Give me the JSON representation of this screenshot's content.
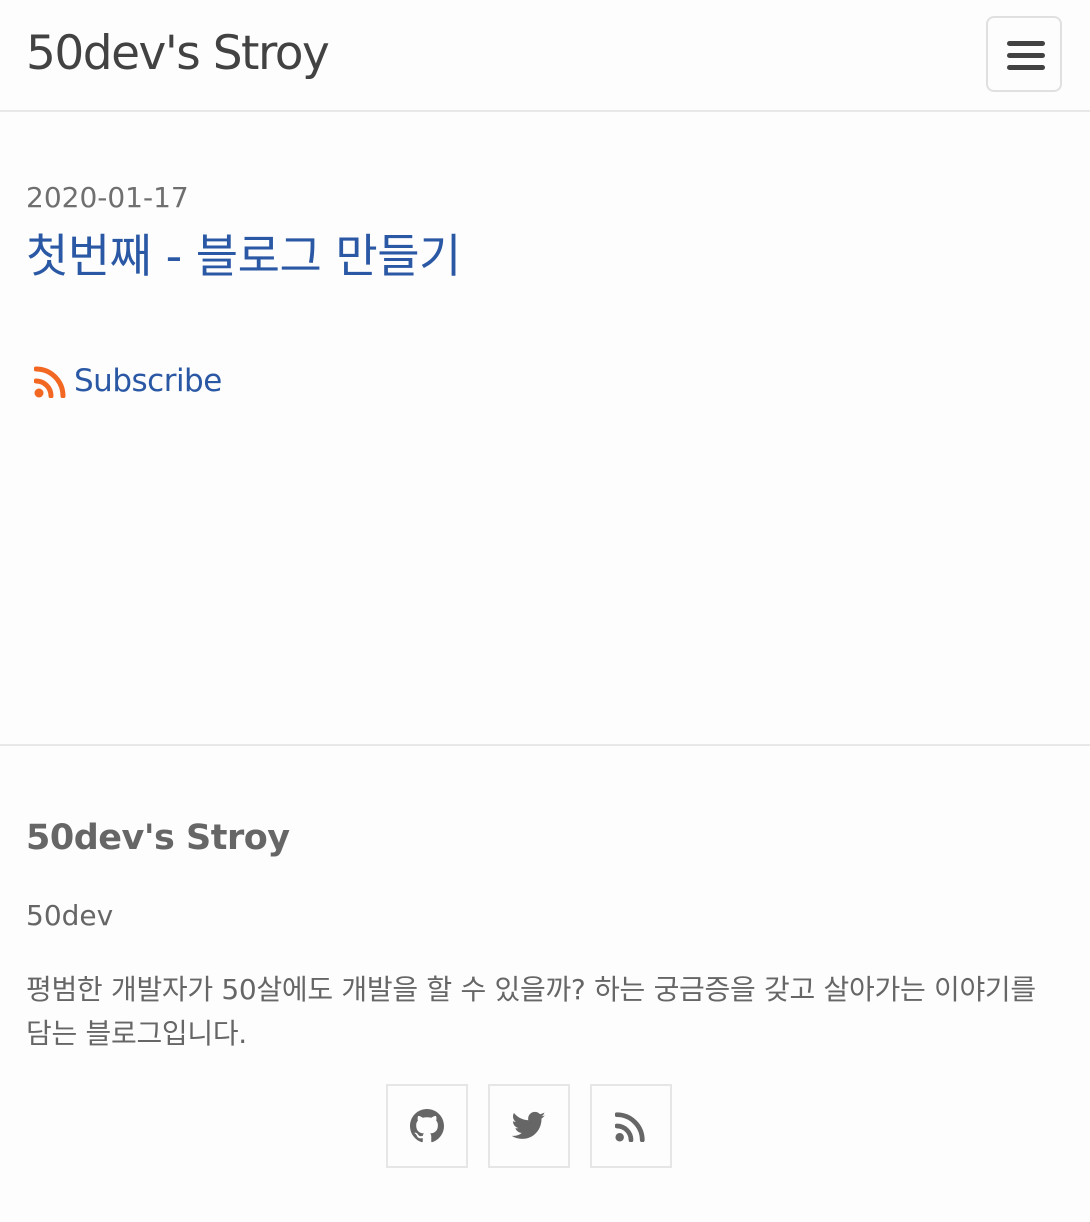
{
  "header": {
    "site_title": "50dev's Stroy",
    "menu_icon": "hamburger-menu-icon"
  },
  "post": {
    "date": "2020-01-17",
    "title": "첫번째 - 블로그 만들기"
  },
  "subscribe": {
    "label": "Subscribe",
    "icon": "rss-icon",
    "icon_color": "#f26722"
  },
  "footer": {
    "heading": "50dev's Stroy",
    "author": "50dev",
    "description": "평범한 개발자가 50살에도 개발을 할 수 있을까? 하는 궁금증을 갖고 살아가는 이야기를 담는 블로그입니다.",
    "social": [
      {
        "name": "github",
        "icon": "github-icon"
      },
      {
        "name": "twitter",
        "icon": "twitter-icon"
      },
      {
        "name": "rss",
        "icon": "rss-icon"
      }
    ]
  },
  "colors": {
    "link": "#2a58a4",
    "muted_text": "#666666",
    "border": "#e8e8e8",
    "background": "#fdfdfd"
  }
}
